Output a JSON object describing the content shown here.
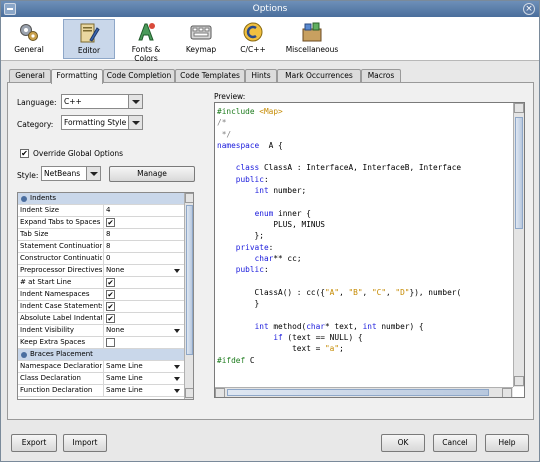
{
  "window": {
    "title": "Options",
    "close_glyph": "×"
  },
  "toolbar": {
    "items": [
      {
        "label": "General",
        "icon": "gears-icon"
      },
      {
        "label": "Editor",
        "icon": "editor-icon",
        "selected": true
      },
      {
        "label": "Fonts & Colors",
        "icon": "fonts-colors-icon"
      },
      {
        "label": "Keymap",
        "icon": "keymap-icon"
      },
      {
        "label": "C/C++",
        "icon": "cpp-icon"
      },
      {
        "label": "Miscellaneous",
        "icon": "miscellaneous-icon"
      }
    ]
  },
  "tabs": [
    {
      "label": "General"
    },
    {
      "label": "Formatting",
      "selected": true
    },
    {
      "label": "Code Completion"
    },
    {
      "label": "Code Templates"
    },
    {
      "label": "Hints"
    },
    {
      "label": "Mark Occurrences"
    },
    {
      "label": "Macros"
    }
  ],
  "form": {
    "language_label": "Language:",
    "language_value": "C++",
    "category_label": "Category:",
    "category_value": "Formatting Style",
    "override_label": "Override Global Options",
    "override_checked": true,
    "style_label": "Style:",
    "style_value": "NetBeans",
    "manage_button": "Manage"
  },
  "properties": {
    "groups": [
      {
        "title": "Indents",
        "rows": [
          {
            "name": "Indent Size",
            "value": "4",
            "kind": "text"
          },
          {
            "name": "Expand Tabs to Spaces",
            "value": "✔",
            "kind": "check"
          },
          {
            "name": "Tab Size",
            "value": "8",
            "kind": "text"
          },
          {
            "name": "Statement Continuation",
            "value": "8",
            "kind": "text"
          },
          {
            "name": "Constructor Continuation",
            "value": "0",
            "kind": "text"
          },
          {
            "name": "Preprocessor Directives",
            "value": "None",
            "kind": "combo"
          },
          {
            "name": "# at Start Line",
            "value": "✔",
            "kind": "check"
          },
          {
            "name": "Indent Namespaces",
            "value": "✔",
            "kind": "check"
          },
          {
            "name": "Indent Case Statements",
            "value": "✔",
            "kind": "check"
          },
          {
            "name": "Absolute Label Indentation",
            "value": "✔",
            "kind": "check"
          },
          {
            "name": "Indent Visibility",
            "value": "None",
            "kind": "combo"
          },
          {
            "name": "Keep Extra Spaces",
            "value": "",
            "kind": "check"
          }
        ]
      },
      {
        "title": "Braces Placement",
        "rows": [
          {
            "name": "Namespace Declaration",
            "value": "Same Line",
            "kind": "combo"
          },
          {
            "name": "Class Declaration",
            "value": "Same Line",
            "kind": "combo"
          },
          {
            "name": "Function Declaration",
            "value": "Same Line",
            "kind": "combo"
          }
        ]
      }
    ]
  },
  "preview": {
    "label": "Preview:",
    "lines": [
      [
        [
          "pp",
          "#include "
        ],
        [
          "str",
          "<Map>"
        ]
      ],
      [
        [
          "cmt",
          "/*"
        ]
      ],
      [
        [
          "cmt",
          " */"
        ]
      ],
      [
        [
          "kw",
          "namespace"
        ],
        [
          "",
          "  A {"
        ]
      ],
      [
        [
          "",
          ""
        ]
      ],
      [
        [
          "",
          "    "
        ],
        [
          "kw",
          "class"
        ],
        [
          "",
          " ClassA : InterfaceA, InterfaceB, Interface"
        ]
      ],
      [
        [
          "",
          "    "
        ],
        [
          "kw",
          "public"
        ],
        [
          "",
          ":"
        ]
      ],
      [
        [
          "",
          "        "
        ],
        [
          "kw",
          "int"
        ],
        [
          "",
          " number;"
        ]
      ],
      [
        [
          "",
          ""
        ]
      ],
      [
        [
          "",
          "        "
        ],
        [
          "kw",
          "enum"
        ],
        [
          "",
          " inner {"
        ]
      ],
      [
        [
          "",
          "            PLUS, MINUS"
        ]
      ],
      [
        [
          "",
          "        };"
        ]
      ],
      [
        [
          "",
          "    "
        ],
        [
          "kw",
          "private"
        ],
        [
          "",
          ":"
        ]
      ],
      [
        [
          "",
          "        "
        ],
        [
          "kw",
          "char"
        ],
        [
          "",
          "** cc;"
        ]
      ],
      [
        [
          "",
          "    "
        ],
        [
          "kw",
          "public"
        ],
        [
          "",
          ":"
        ]
      ],
      [
        [
          "",
          ""
        ]
      ],
      [
        [
          "",
          "        ClassA() : cc({"
        ],
        [
          "str",
          "\"A\""
        ],
        [
          "",
          ", "
        ],
        [
          "str",
          "\"B\""
        ],
        [
          "",
          ", "
        ],
        [
          "str",
          "\"C\""
        ],
        [
          "",
          ", "
        ],
        [
          "str",
          "\"D\""
        ],
        [
          "",
          "}), number("
        ]
      ],
      [
        [
          "",
          "        }"
        ]
      ],
      [
        [
          "",
          ""
        ]
      ],
      [
        [
          "",
          "        "
        ],
        [
          "kw",
          "int"
        ],
        [
          "",
          " method("
        ],
        [
          "kw",
          "char"
        ],
        [
          "",
          "* text, "
        ],
        [
          "kw",
          "int"
        ],
        [
          "",
          " number) {"
        ]
      ],
      [
        [
          "",
          "            "
        ],
        [
          "kw",
          "if"
        ],
        [
          "",
          " (text == NULL) {"
        ]
      ],
      [
        [
          "",
          "                text = "
        ],
        [
          "str",
          "\"a\""
        ],
        [
          "",
          ";"
        ]
      ],
      [
        [
          "pp",
          "#ifdef"
        ],
        [
          "",
          " C"
        ]
      ]
    ]
  },
  "buttons": {
    "export": "Export",
    "import": "Import",
    "ok": "OK",
    "cancel": "Cancel",
    "help": "Help"
  }
}
